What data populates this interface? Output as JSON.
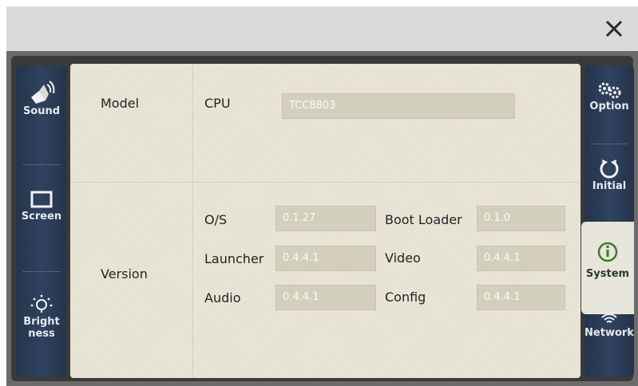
{
  "sidebar_left": [
    {
      "label": "Sound",
      "icon": "speaker-icon"
    },
    {
      "label": "Screen",
      "icon": "monitor-icon"
    },
    {
      "label": "Bright ness",
      "label_lines": [
        "Bright",
        "ness"
      ],
      "icon": "brightness-icon"
    }
  ],
  "sidebar_right": [
    {
      "label": "Option",
      "icon": "gears-icon"
    },
    {
      "label": "Initial",
      "icon": "refresh-icon"
    },
    {
      "label": "System",
      "icon": "info-icon",
      "selected": true
    },
    {
      "label": "Network",
      "icon": "wifi-icon"
    }
  ],
  "panel": {
    "model_label": "Model",
    "cpu_label": "CPU",
    "cpu_value": "TCC8803",
    "version_label": "Version",
    "rows": [
      {
        "left_label": "O/S",
        "left_value": "0.1.27",
        "right_label": "Boot Loader",
        "right_value": "0.1.0"
      },
      {
        "left_label": "Launcher",
        "left_value": "0.4.4.1",
        "right_label": "Video",
        "right_value": "0.4.4.1"
      },
      {
        "left_label": "Audio",
        "left_value": "0.4.4.1",
        "right_label": "Config",
        "right_value": "0.4.4.1"
      }
    ]
  },
  "colors": {
    "sidebar": "#2f4260",
    "panel": "#e9e6d8",
    "field": "#d3cfbd",
    "topbar": "#dadada"
  }
}
